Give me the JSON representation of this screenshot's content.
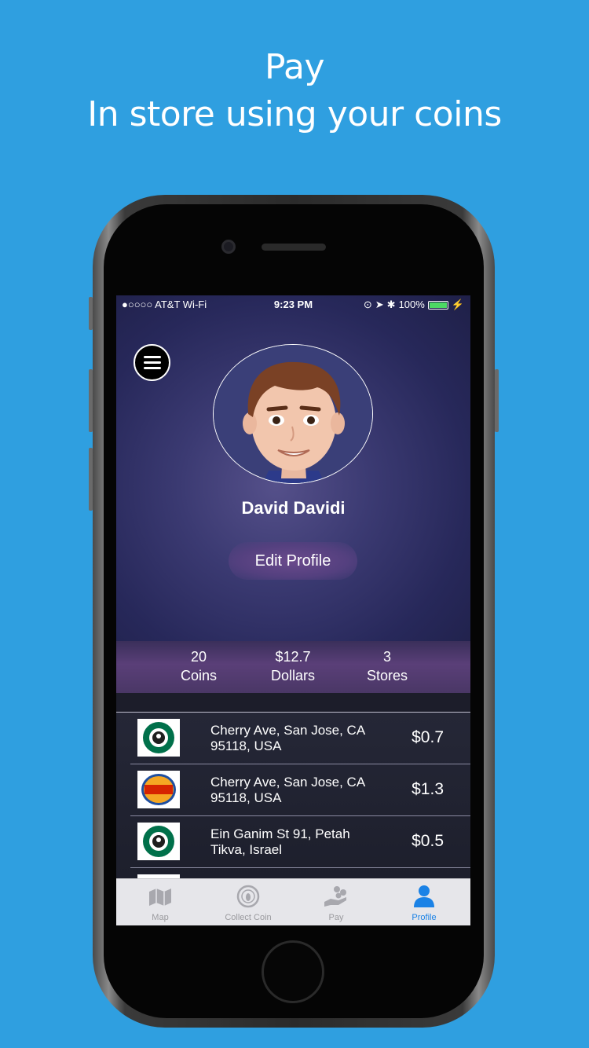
{
  "headline": {
    "line1": "Pay",
    "line2": "In store using your coins"
  },
  "status_bar": {
    "carrier": "●○○○○ AT&T Wi-Fi",
    "time": "9:23 PM",
    "battery": "100%"
  },
  "profile": {
    "name": "David Davidi",
    "edit_label": "Edit Profile"
  },
  "stats": [
    {
      "value": "20",
      "label": "Coins"
    },
    {
      "value": "$12.7",
      "label": "Dollars"
    },
    {
      "value": "3",
      "label": "Stores"
    }
  ],
  "transactions": [
    {
      "store": "starbucks",
      "address_line1": "Cherry Ave, San Jose, CA",
      "address_line2": "95118, USA",
      "amount": "$0.7"
    },
    {
      "store": "burger-king",
      "address_line1": "Cherry Ave, San Jose, CA",
      "address_line2": "95118, USA",
      "amount": "$1.3"
    },
    {
      "store": "starbucks",
      "address_line1": "Ein Ganim St 91, Petah",
      "address_line2": "Tikva, Israel",
      "amount": "$0.5"
    }
  ],
  "tabs": [
    {
      "label": "Map",
      "icon": "map-icon"
    },
    {
      "label": "Collect Coin",
      "icon": "coin-icon"
    },
    {
      "label": "Pay",
      "icon": "pay-hand-icon"
    },
    {
      "label": "Profile",
      "icon": "person-icon",
      "active": true
    }
  ],
  "colors": {
    "background": "#2f9fe0",
    "active_tab": "#1a82e6",
    "battery": "#4cd964"
  }
}
